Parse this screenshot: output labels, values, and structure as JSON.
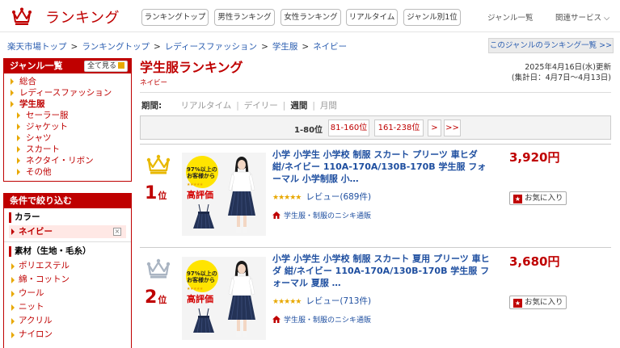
{
  "header": {
    "logo_text": "ランキング",
    "nav_buttons": [
      "ランキングトップ",
      "男性ランキング",
      "女性ランキング",
      "リアルタイム",
      "ジャンル別1位"
    ],
    "nav_links": [
      "ジャンル一覧",
      "関連サービス ⌵"
    ]
  },
  "breadcrumb": [
    "楽天市場トップ",
    "ランキングトップ",
    "レディースファッション",
    "学生服",
    "ネイビー"
  ],
  "breadcrumb_sep": ">",
  "genre_ranking_link": "このジャンルのランキング一覧 >>",
  "sidebar": {
    "genre_title": "ジャンル一覧",
    "see_all": "全て見る",
    "genres": [
      {
        "label": "総合",
        "level": 0,
        "bold": false
      },
      {
        "label": "レディースファッション",
        "level": 0,
        "bold": false
      },
      {
        "label": "学生服",
        "level": 0,
        "bold": true
      },
      {
        "label": "セーラー服",
        "level": 1,
        "bold": false
      },
      {
        "label": "ジャケット",
        "level": 1,
        "bold": false
      },
      {
        "label": "シャツ",
        "level": 1,
        "bold": false
      },
      {
        "label": "スカート",
        "level": 1,
        "bold": false
      },
      {
        "label": "ネクタイ・リボン",
        "level": 1,
        "bold": false
      },
      {
        "label": "その他",
        "level": 1,
        "bold": false
      }
    ],
    "filter_title": "条件で絞り込む",
    "color_label": "カラー",
    "color_selected": "ネイビー",
    "material_label": "素材（生地・毛糸）",
    "materials": [
      "ポリエステル",
      "綿・コットン",
      "ウール",
      "ニット",
      "アクリル",
      "ナイロン"
    ]
  },
  "main": {
    "title": "学生服ランキング",
    "subtitle": "ネイビー",
    "updated_line1": "2025年4月16日(水)更新",
    "updated_line2": "(集計日：4月7日〜4月13日)",
    "period_label": "期間:",
    "periods": [
      {
        "label": "リアルタイム",
        "active": false
      },
      {
        "label": "デイリー",
        "active": false
      },
      {
        "label": "週間",
        "active": true
      },
      {
        "label": "月間",
        "active": false
      }
    ],
    "pager": {
      "current": "1-80位",
      "buttons": [
        "81-160位",
        "161-238位",
        ">",
        ">>"
      ]
    }
  },
  "items": [
    {
      "rank": "1",
      "rank_unit": "位",
      "crown_color": "#e8b800",
      "title": "小学 小学生 小学校 制服 スカート プリーツ 車ヒダ 紺/ネイビー 110A-170A/130B-170B 学生服 フォーマル 小学制服 小…",
      "stars": "★★★★★",
      "review": "レビュー(689件)",
      "shop": "学生服・制服のニシキ通販",
      "price": "3,920円",
      "fav": "お気に入り",
      "thumb_badge_top": "97%以上の\nお客様から",
      "thumb_badge_main": "高評価"
    },
    {
      "rank": "2",
      "rank_unit": "位",
      "crown_color": "#a9b4c2",
      "title": "小学 小学生 小学校 制服 スカート 夏用 プリーツ 車ヒダ 紺/ネイビー 110A-170A/130B-170B 学生服 フォーマル 夏服 …",
      "stars": "★★★★★",
      "review": "レビュー(713件)",
      "shop": "学生服・制服のニシキ通販",
      "price": "3,680円",
      "fav": "お気に入り",
      "thumb_badge_top": "97%以上の\nお客様から",
      "thumb_badge_main": "高評価"
    }
  ],
  "colors": {
    "brand": "#bf0000",
    "link": "#1f4fa0",
    "star": "#e8a800"
  }
}
